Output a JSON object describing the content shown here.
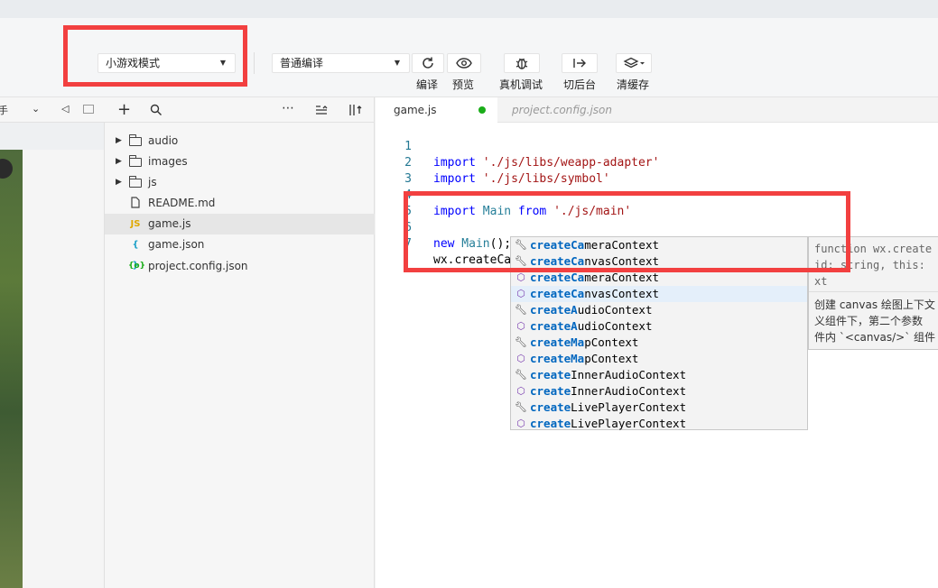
{
  "toolbar": {
    "mode_select": "小游戏模式",
    "compile_select": "普通编译",
    "buttons": [
      {
        "label": "编译",
        "icon": "refresh-icon"
      },
      {
        "label": "预览",
        "icon": "eye-icon"
      },
      {
        "label": "真机调试",
        "icon": "bug-icon"
      },
      {
        "label": "切后台",
        "icon": "switch-background-icon"
      },
      {
        "label": "清缓存",
        "icon": "layers-icon"
      }
    ]
  },
  "left_panel": {
    "partial_label": "手"
  },
  "explorer": {
    "items": [
      {
        "name": "audio",
        "type": "folder"
      },
      {
        "name": "images",
        "type": "folder"
      },
      {
        "name": "js",
        "type": "folder"
      },
      {
        "name": "README.md",
        "type": "file",
        "icon": "JS"
      },
      {
        "name": "game.js",
        "type": "js",
        "icon": "JS"
      },
      {
        "name": "game.json",
        "type": "json",
        "icon": "{ }"
      },
      {
        "name": "project.config.json",
        "type": "config",
        "icon": "{o}"
      }
    ]
  },
  "editor": {
    "tabs": [
      {
        "label": "game.js"
      },
      {
        "label": "project.config.json"
      }
    ],
    "lines": [
      {
        "n": "1",
        "kw": "import",
        "rest": " './js/libs/weapp-adapter'"
      },
      {
        "n": "2",
        "kw": "import",
        "rest": " './js/libs/symbol'"
      },
      {
        "n": "3",
        "kw": "",
        "rest": ""
      },
      {
        "n": "4",
        "kw": "import",
        "cls": " Main",
        "kw2": " from",
        "rest": " './js/main'"
      },
      {
        "n": "5",
        "kw": "",
        "rest": ""
      },
      {
        "n": "6",
        "kw": "new",
        "cls": " Main",
        "rest": "();"
      },
      {
        "n": "7",
        "kw": "",
        "rest": "wx.createCa"
      }
    ]
  },
  "suggestions": {
    "items": [
      {
        "match": "createCa",
        "rest": "meraContext",
        "kind": "wrench-icon"
      },
      {
        "match": "createCa",
        "rest": "nvasContext",
        "kind": "wrench-icon"
      },
      {
        "match": "createCa",
        "rest": "meraContext",
        "kind": "cube-icon"
      },
      {
        "match": "createCa",
        "rest": "nvasContext",
        "kind": "cube-icon"
      },
      {
        "match": "createA",
        "rest": "udioContext",
        "kind": "wrench-icon"
      },
      {
        "match": "createA",
        "rest": "udioContext",
        "kind": "cube-icon"
      },
      {
        "match": "createMa",
        "rest": "pContext",
        "kind": "wrench-icon"
      },
      {
        "match": "createMa",
        "rest": "pContext",
        "kind": "cube-icon"
      },
      {
        "match": "create",
        "rest": "InnerAudioContext",
        "kind": "wrench-icon"
      },
      {
        "match": "create",
        "rest": "InnerAudioContext",
        "kind": "cube-icon"
      },
      {
        "match": "create",
        "rest": "LivePlayerContext",
        "kind": "wrench-icon"
      },
      {
        "match": "create",
        "rest": "LivePlayerContext",
        "kind": "cube-icon"
      }
    ],
    "details": {
      "signature": "function wx.create\nid: string, this:\nxt",
      "doc": "创建 canvas 绘图上下文\n义组件下，第二个参数\n件内 `<canvas/>` 组件"
    }
  }
}
